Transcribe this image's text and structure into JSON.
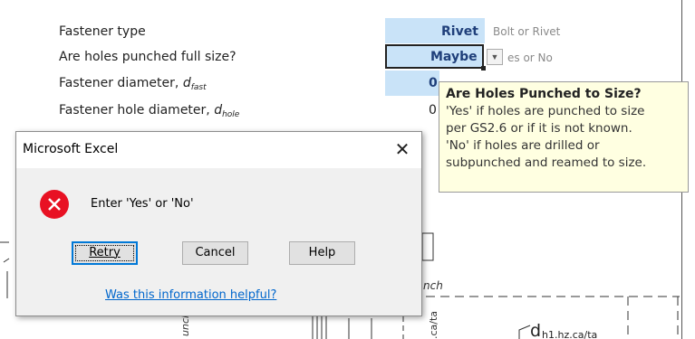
{
  "sheet": {
    "rows": [
      {
        "label": "Fastener type"
      },
      {
        "label": "Are holes punched full size?"
      },
      {
        "label_prefix": "Fastener diameter, ",
        "sym": "d",
        "sub": "fast"
      },
      {
        "label_prefix": "Fastener hole diameter, ",
        "sym": "d",
        "sub": "hole"
      }
    ],
    "fastener_type_value": "Rivet",
    "fastener_type_hint": "Bolt or Rivet",
    "holes_value": "Maybe",
    "holes_hint": "es or No",
    "partial_row3": "0",
    "partial_row4": "0",
    "dropdown_arrow": "▼"
  },
  "tooltip": {
    "title": "Are Holes Punched to Size?",
    "lines": [
      "'Yes' if holes are punched to size",
      "per GS2.6 or if it is not known.",
      "'No' if holes are drilled or",
      "subpunched and reamed to size."
    ]
  },
  "diagram": {
    "label_inch": "nch",
    "label_unch": "unch",
    "label_ca_ta": ".ca/ta",
    "label_d": "d",
    "label_d_sub": "h1.hz.ca/ta"
  },
  "dialog": {
    "title": "Microsoft Excel",
    "close_glyph": "✕",
    "message": "Enter 'Yes' or 'No'",
    "buttons": {
      "retry": "Retry",
      "cancel": "Cancel",
      "help": "Help"
    },
    "help_link": "Was this information helpful?",
    "icon": "error-icon"
  },
  "colors": {
    "input_cell": "#c9e3f8",
    "value_text": "#1f3f7a",
    "tooltip_bg": "#ffffe1",
    "error_red": "#e81123",
    "link_blue": "#0066cc"
  }
}
